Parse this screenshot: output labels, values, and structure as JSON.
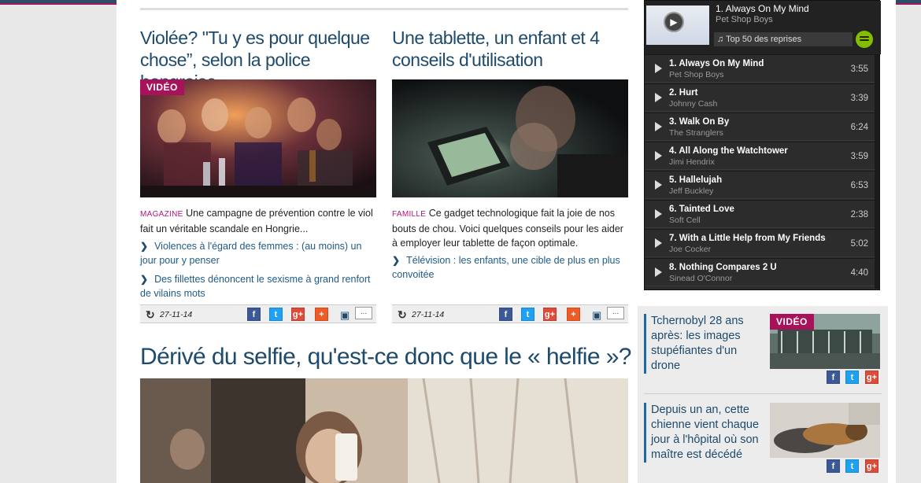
{
  "articles": [
    {
      "title": "Violée? \"Tu y es pour quelque chose”, selon la police hongroise",
      "badge": "VIDÉO",
      "category": "MAGAZINE",
      "lead": "Une campagne de prévention contre le viol fait un véritable scandale en Hongrie...",
      "related": [
        "Violences à l'égard des femmes : (au moins) un jour pour y penser",
        "Des fillettes dénoncent le sexisme à grand renfort de vilains mots"
      ],
      "date": "27-11-14"
    },
    {
      "title": "Une tablette, un enfant et 4 conseils d'utilisation",
      "badge": "",
      "category": "FAMILLE",
      "lead": "Ce gadget technologique fait la joie de nos bouts de chou. Voici quelques conseils pour les aider à employer leur tablette de façon optimale.",
      "related": [
        "Télévision : les enfants, une cible de plus en plus convoitée"
      ],
      "date": "27-11-14"
    }
  ],
  "main_article": {
    "title": "Dérivé du selfie, qu'est-ce donc que le « helfie »?"
  },
  "share": {
    "facebook": "f",
    "twitter": "t",
    "google": "g+",
    "more": "+"
  },
  "player": {
    "now_playing": {
      "title": "1. Always On My Mind",
      "artist": "Pet Shop Boys"
    },
    "playlist": "Top 50 des reprises",
    "tracks": [
      {
        "title": "1. Always On My Mind",
        "artist": "Pet Shop Boys",
        "duration": "3:55"
      },
      {
        "title": "2. Hurt",
        "artist": "Johnny Cash",
        "duration": "3:39"
      },
      {
        "title": "3. Walk On By",
        "artist": "The Stranglers",
        "duration": "6:24"
      },
      {
        "title": "4. All Along the Watchtower",
        "artist": "Jimi Hendrix",
        "duration": "3:59"
      },
      {
        "title": "5. Hallelujah",
        "artist": "Jeff Buckley",
        "duration": "6:53"
      },
      {
        "title": "6. Tainted Love",
        "artist": "Soft Cell",
        "duration": "2:38"
      },
      {
        "title": "7. With a Little Help from My Friends",
        "artist": "Joe Cocker",
        "duration": "5:02"
      },
      {
        "title": "8. Nothing Compares 2 U",
        "artist": "Sinead O'Connor",
        "duration": "4:40"
      }
    ]
  },
  "sidebar": [
    {
      "title": "Tchernobyl 28 ans après: les images stupéfiantes d'un drone",
      "badge": "VIDÉO"
    },
    {
      "title": "Depuis un an, cette chienne vient chaque jour à l'hôpital où son maître est décédé",
      "badge": ""
    }
  ]
}
